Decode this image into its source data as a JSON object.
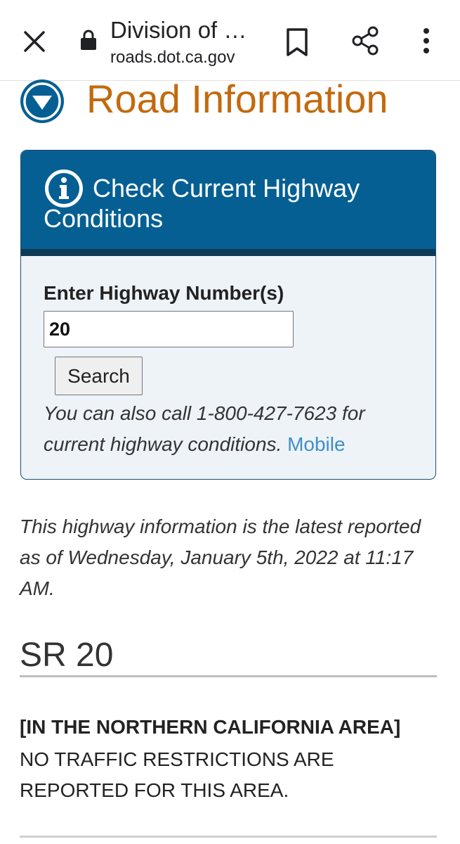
{
  "browser": {
    "page_title": "Division of …",
    "url": "roads.dot.ca.gov"
  },
  "page": {
    "heading": "Road Information"
  },
  "panel": {
    "title": "Check Current Highway Conditions",
    "field_label": "Enter Highway Number(s)",
    "field_value": "20",
    "search_label": "Search",
    "call_text": "You can also call 1-800-427-7623 for current highway conditions.",
    "mobile_link": "Mobile"
  },
  "report": {
    "latest_text": "This highway information is the latest reported as of Wednesday, January 5th, 2022 at 11:17 AM.",
    "route": "SR 20",
    "area_title": "[IN THE NORTHERN CALIFORNIA AREA]",
    "area_text": "NO TRAFFIC RESTRICTIONS ARE REPORTED FOR THIS AREA."
  },
  "colors": {
    "heading_orange": "#c26a0e",
    "panel_blue": "#055f93",
    "link_blue": "#3f8fc6"
  }
}
